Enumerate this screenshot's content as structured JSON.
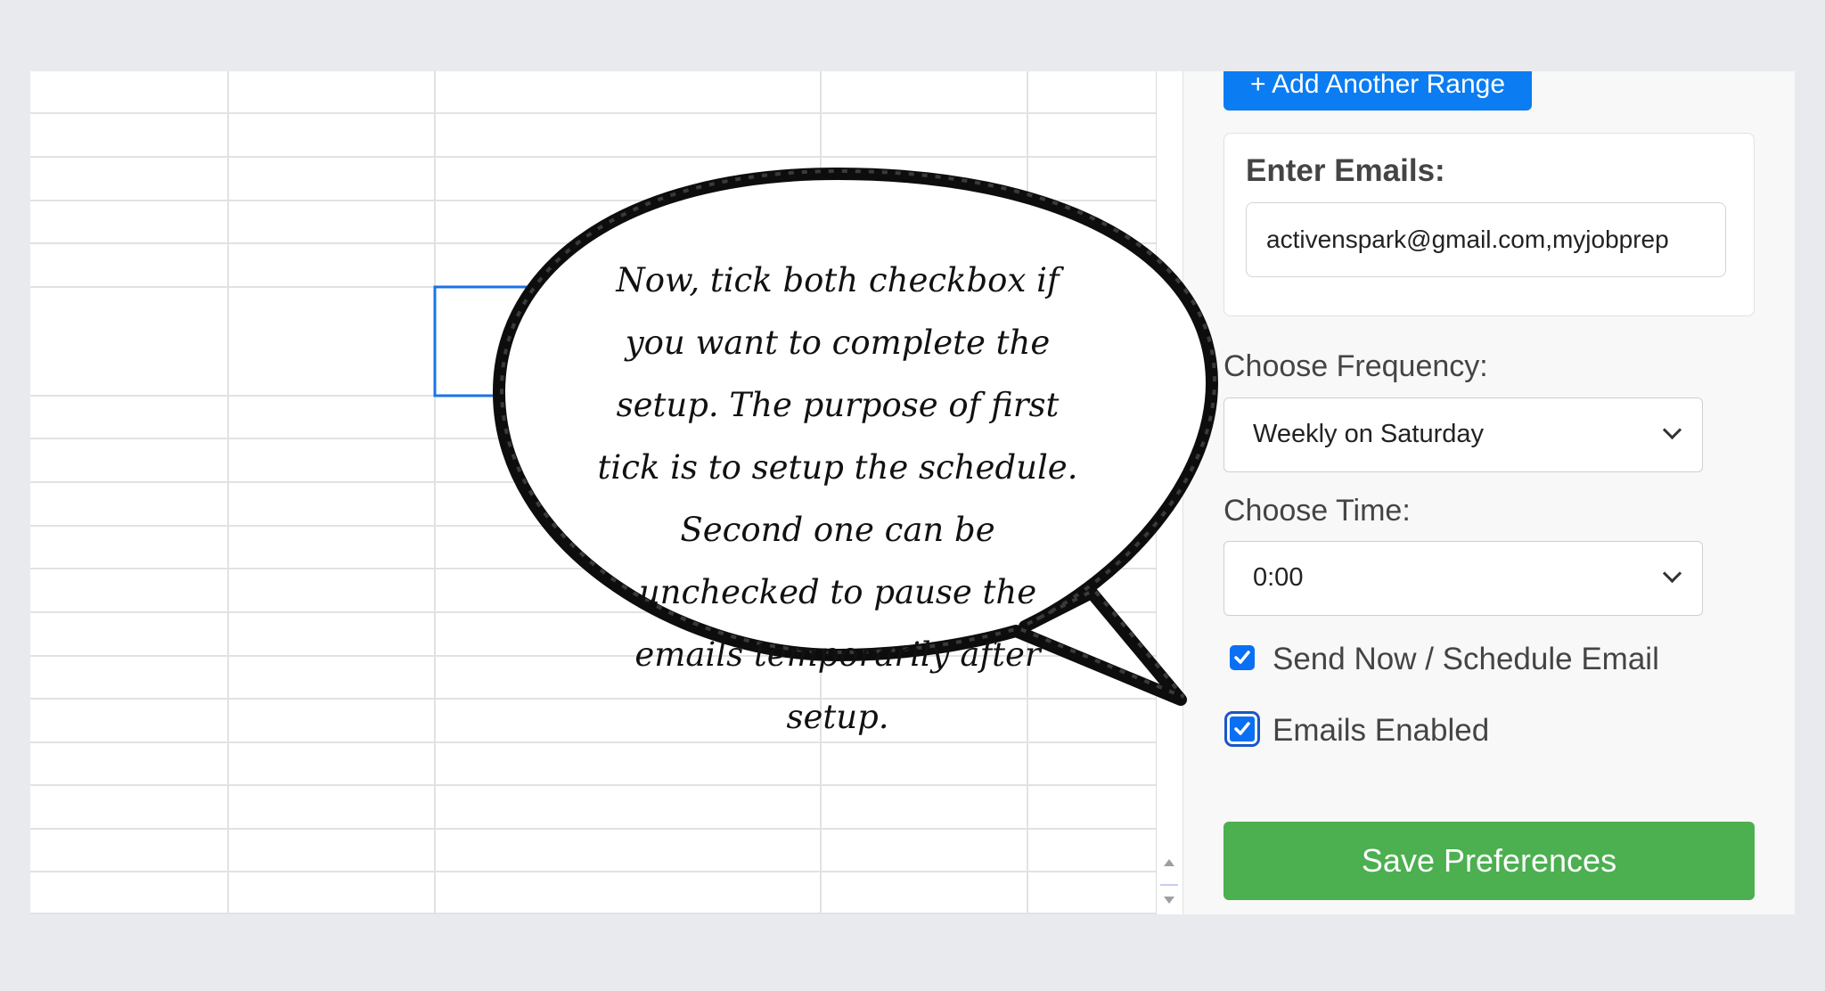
{
  "panel": {
    "add_range_label": "+ Add Another Range",
    "emails": {
      "label": "Enter Emails:",
      "value": "activenspark@gmail.com,myjobprep"
    },
    "frequency": {
      "label": "Choose Frequency:",
      "selected": "Weekly on Saturday"
    },
    "time": {
      "label": "Choose Time:",
      "selected": "0:00"
    },
    "checkboxes": [
      {
        "label": "Send Now / Schedule Email",
        "checked": true
      },
      {
        "label": "Emails Enabled",
        "checked": true
      }
    ],
    "save_label": "Save Preferences"
  },
  "callout": {
    "text": "Now, tick both checkbox if you want to complete the setup. The purpose of first tick is to setup the schedule. Second one can be unchecked to pause the emails temporarily after setup."
  },
  "colors": {
    "primary_blue": "#0b7cf2",
    "save_green": "#4caf50",
    "checkbox_blue": "#0b6ff3",
    "selection_blue": "#1a73e8"
  },
  "icons": [
    "checkmark-icon",
    "chevron-down-icon",
    "scroll-up-icon",
    "scroll-down-icon"
  ]
}
